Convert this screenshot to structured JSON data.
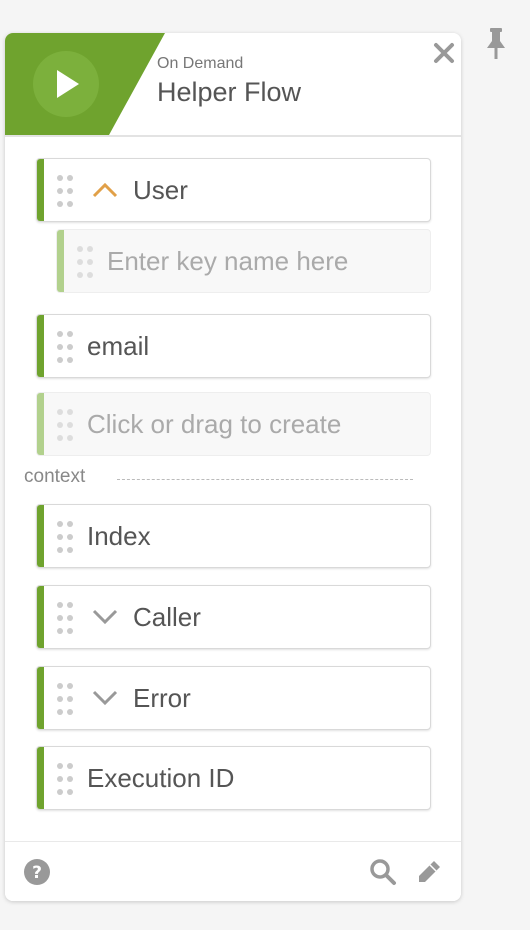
{
  "header": {
    "subtitle": "On Demand",
    "title": "Helper Flow",
    "accent_color": "#6fa32e",
    "play_icon": "play-icon",
    "close_icon": "close-icon"
  },
  "rows": [
    {
      "label": "User",
      "expanded": true,
      "icon": "chevron-up-icon"
    },
    {
      "placeholder": "Enter key name here"
    },
    {
      "label": "email"
    },
    {
      "placeholder": "Click or drag to create"
    }
  ],
  "context": {
    "label": "context",
    "items": [
      {
        "label": "Index"
      },
      {
        "label": "Caller",
        "expanded": false,
        "icon": "chevron-down-icon"
      },
      {
        "label": "Error",
        "expanded": false,
        "icon": "chevron-down-icon"
      },
      {
        "label": "Execution ID"
      }
    ]
  },
  "footer": {
    "help_icon": "help-icon",
    "search_icon": "search-icon",
    "edit_icon": "pencil-icon"
  },
  "pin_icon": "pin-icon"
}
